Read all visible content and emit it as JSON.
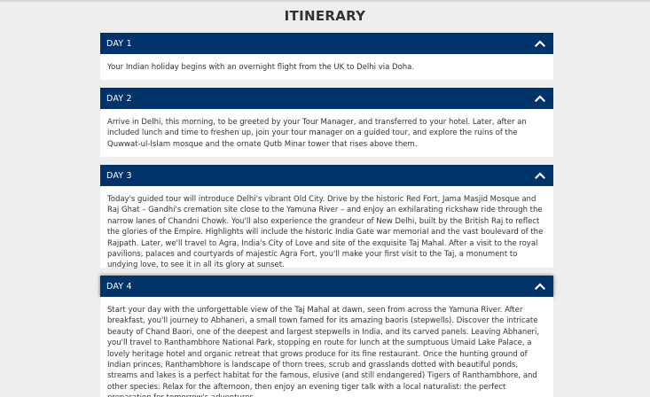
{
  "page": {
    "title": "ITINERARY"
  },
  "days": [
    {
      "label": "DAY 1",
      "text": "Your Indian holiday begins with an overnight flight from the UK to Delhi via Doha."
    },
    {
      "label": "DAY 2",
      "text": "Arrive in Delhi, this morning, to be greeted by your Tour Manager, and transferred to your hotel. Later, after an included lunch and time to freshen up, join your tour manager on a guided tour, and explore the ruins of the Quwwat-ul-Islam mosque and the ornate Qutb Minar tower that rises above them."
    },
    {
      "label": "DAY 3",
      "text": "Today's guided tour will introduce Delhi's vibrant Old City. Drive by the historic Red Fort, Jama Masjid Mosque and Raj Ghat – Gandhi's cremation site close to the Yamuna River – and enjoy an exhilarating rickshaw ride through the narrow lanes of Chandni Chowk. You'll also experience the grandeur of New Delhi, built by the British Raj to reflect the glories of the Empire. Highlights will include the historic India Gate war memorial and the vast boulevard of the Rajpath. Later, we'll travel to Agra, India's City of Love and site of the exquisite Taj Mahal. After a visit to the royal pavilions, palaces and courtyards of majestic Agra Fort, you'll make your first visit to the Taj, a monument to undying love, to see it in all its glory at sunset."
    },
    {
      "label": "DAY 4",
      "text": "Start your day with the unforgettable view of the Taj Mahal at dawn, seen from across the Yamuna River. After breakfast, you'll journey to Abhaneri, a small town famed for its amazing baoris (stepwells). Discover the intricate beauty of Chand Baori, one of the deepest and largest stepwells in India, and its carved panels. Leaving Abhaneri, you'll travel to Ranthambhore National Park, stopping en route for lunch at the sumptuous Umaid Lake Palace, a lovely heritage hotel and organic retreat that grows produce for its fine restaurant. Once the hunting ground of Indian princes, Ranthambhore is landscape of thorn trees, scrub and grasslands dotted with beautiful ponds, streams and lakes is a perfect habitat for the famous, elusive (and still endangered) Tigers of Ranthambhore, and other species. Relax for the afternoon, then enjoy an evening tiger talk with a local naturalist: the perfect preparation for tomorrow's adventures."
    }
  ],
  "icons": {
    "toggle": "chevron-up-icon"
  },
  "colors": {
    "header_bg": "#00336a",
    "header_text": "#ffffff",
    "page_bg": "#eeeeee",
    "body_bg": "#ffffff",
    "text": "#333333"
  }
}
